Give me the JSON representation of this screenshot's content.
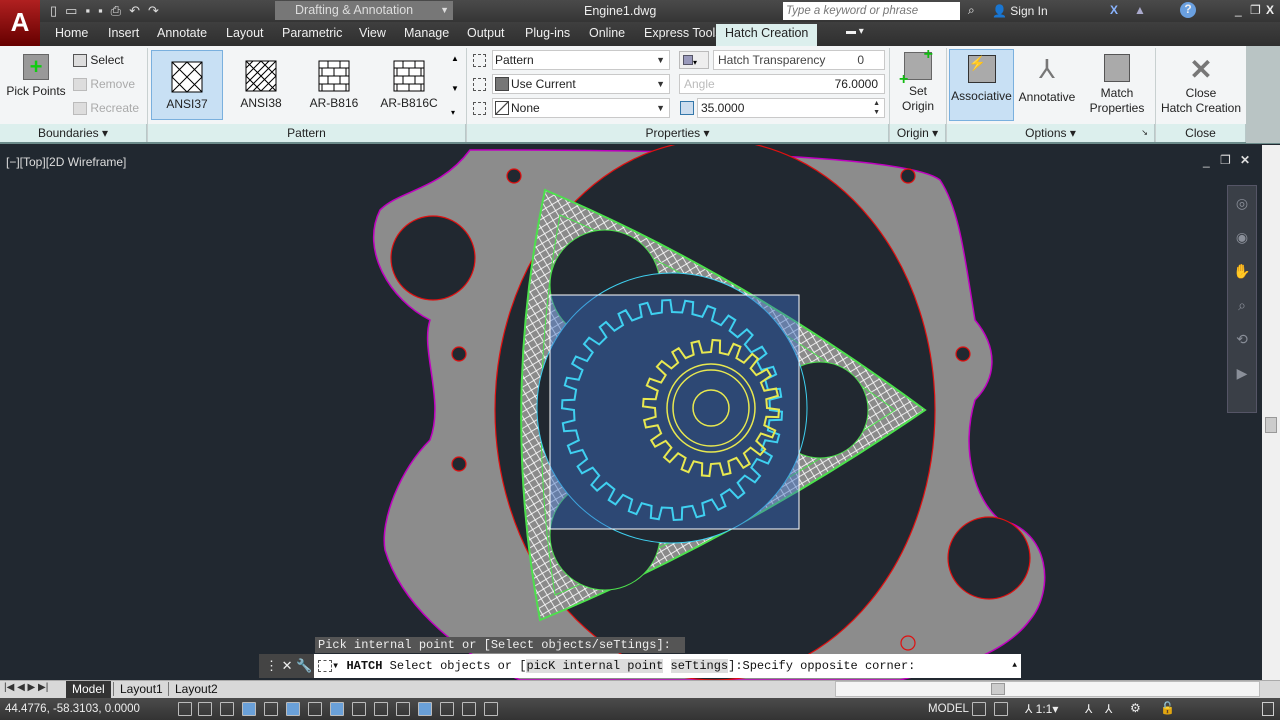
{
  "titlebar": {
    "workspace": "Drafting & Annotation",
    "file_title": "Engine1.dwg",
    "search_placeholder": "Type a keyword or phrase",
    "sign_in": "Sign In"
  },
  "tabs": [
    "Home",
    "Insert",
    "Annotate",
    "Layout",
    "Parametric",
    "View",
    "Manage",
    "Output",
    "Plug-ins",
    "Online",
    "Express Tools",
    "Hatch Creation"
  ],
  "active_tab": "Hatch Creation",
  "ribbon": {
    "boundaries": {
      "label": "Boundaries",
      "pick_points": "Pick Points",
      "select": "Select",
      "remove": "Remove",
      "recreate": "Recreate"
    },
    "pattern": {
      "label": "Pattern",
      "items": [
        "ANSI37",
        "ANSI38",
        "AR-B816",
        "AR-B816C"
      ],
      "selected": "ANSI37"
    },
    "properties": {
      "label": "Properties",
      "type": "Pattern",
      "color": "Use Current",
      "background": "None",
      "transparency_label": "Hatch Transparency",
      "transparency": "0",
      "angle_label": "Angle",
      "angle": "76.0000",
      "scale": "35.0000"
    },
    "origin": {
      "label": "Origin",
      "set_origin_1": "Set",
      "set_origin_2": "Origin"
    },
    "options": {
      "label": "Options",
      "associative": "Associative",
      "annotative": "Annotative",
      "match_1": "Match",
      "match_2": "Properties"
    },
    "close": {
      "label": "Close",
      "btn_1": "Close",
      "btn_2": "Hatch Creation"
    }
  },
  "viewport": {
    "label": "[−][Top][2D Wireframe]"
  },
  "command": {
    "history": "Pick internal point or [Select objects/seTtings]: _S",
    "name": "HATCH",
    "prefix": "Select objects or [",
    "opt1": "picK internal point",
    "opt2": "seTtings",
    "suffix": "]:Specify opposite corner:"
  },
  "layout_tabs": [
    "Model",
    "Layout1",
    "Layout2"
  ],
  "status": {
    "coords": "44.4776, -58.3103, 0.0000",
    "model": "MODEL",
    "scale": "1:1"
  },
  "colors": {
    "hatch_green": "#4de04d",
    "housing": "#8c8c8c",
    "outline": "#c000c0",
    "gear_cyan": "#3fd0f0",
    "gear_yellow": "#e8e850",
    "hole_red": "#e01010"
  }
}
